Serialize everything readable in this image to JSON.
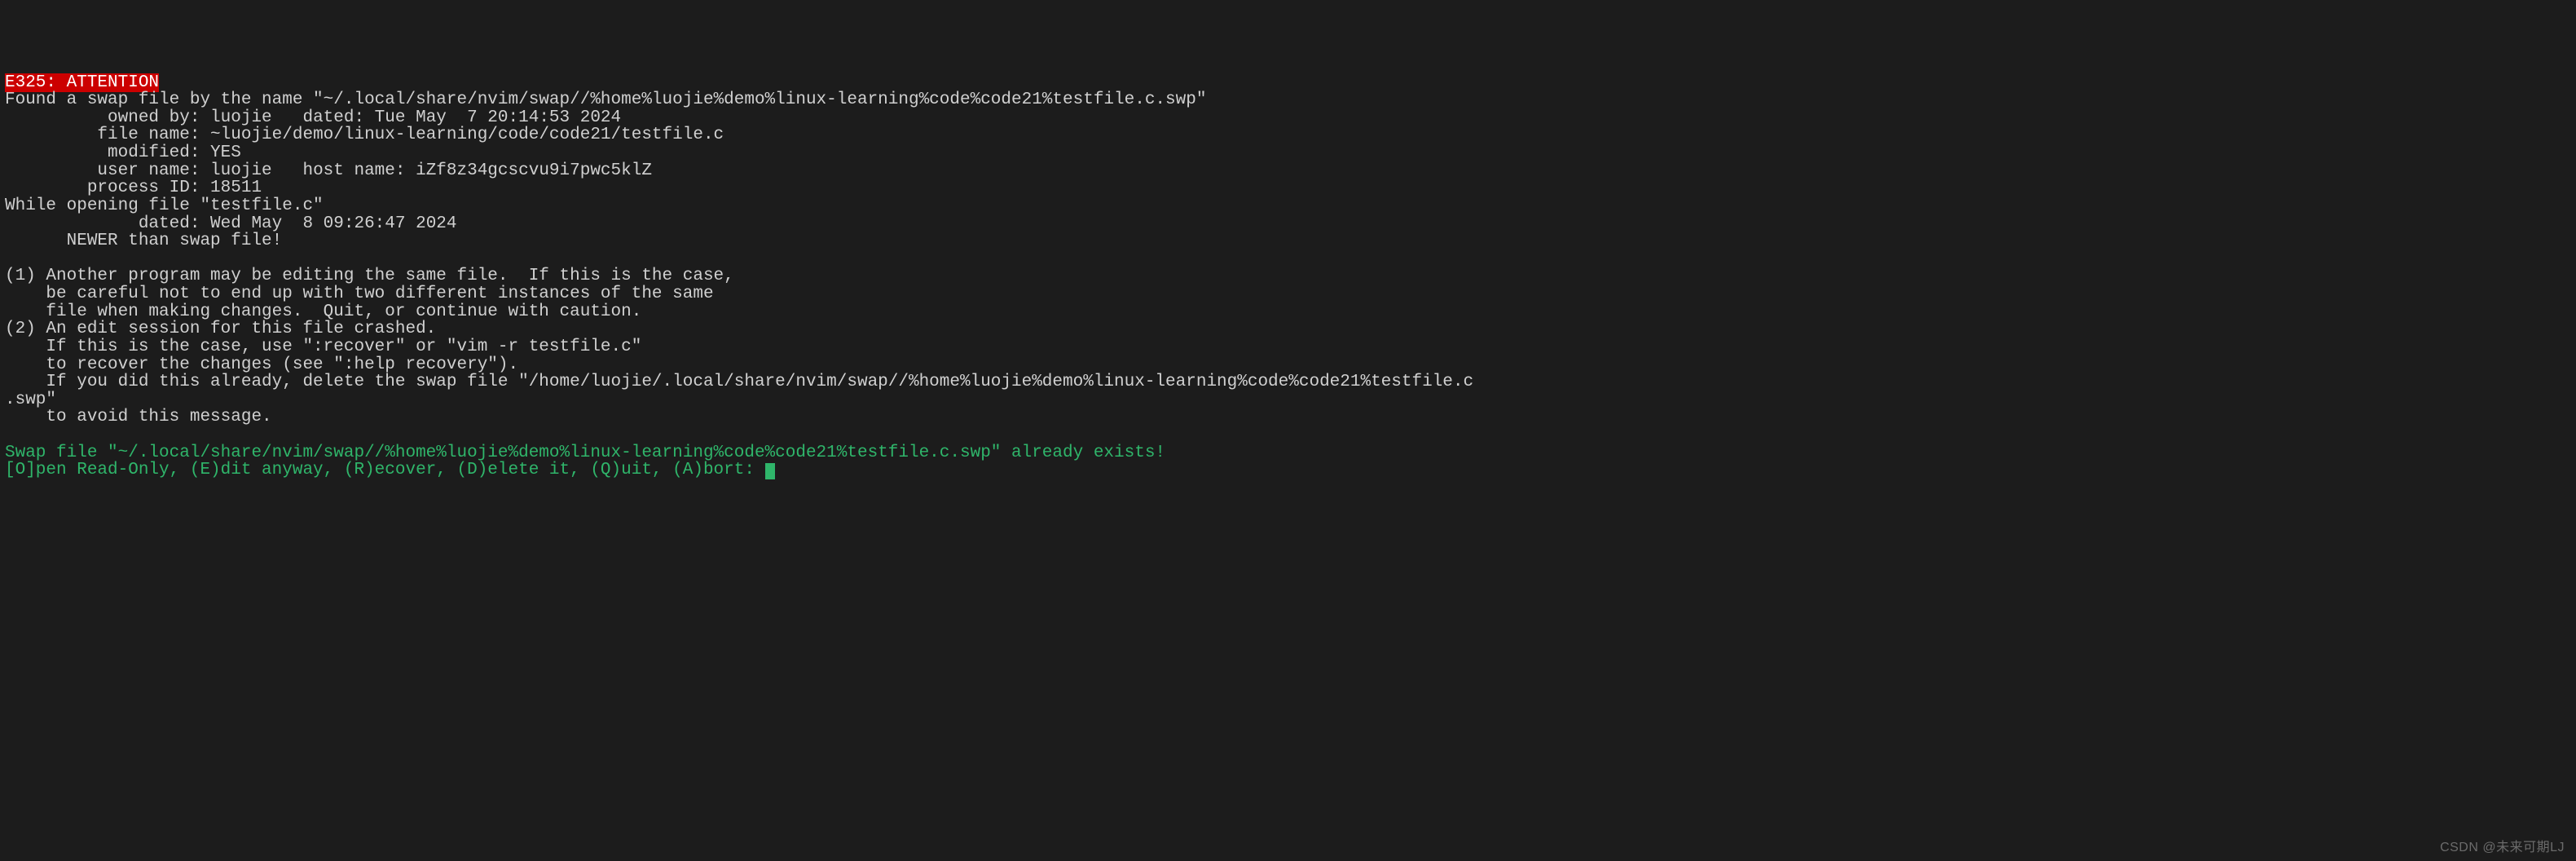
{
  "error_header": "E325: ATTENTION",
  "line_found": "Found a swap file by the name \"~/.local/share/nvim/swap//%home%luojie%demo%linux-learning%code%code21%testfile.c.swp\"",
  "owned_by_label": "          owned by: ",
  "owned_by_value": "luojie   dated: Tue May  7 20:14:53 2024",
  "file_name_label": "         file name: ",
  "file_name_value": "~luojie/demo/linux-learning/code/code21/testfile.c",
  "modified_label": "          modified: ",
  "modified_value": "YES",
  "user_name_label": "         user name: ",
  "user_name_value": "luojie   host name: iZf8z34gcscvu9i7pwc5klZ",
  "process_id_label": "        process ID: ",
  "process_id_value": "18511",
  "while_opening": "While opening file \"testfile.c\"",
  "dated_label": "             dated: ",
  "dated_value": "Wed May  8 09:26:47 2024",
  "newer": "      NEWER than swap file!",
  "blank": "",
  "scenario1_l1": "(1) Another program may be editing the same file.  If this is the case,",
  "scenario1_l2": "    be careful not to end up with two different instances of the same",
  "scenario1_l3": "    file when making changes.  Quit, or continue with caution.",
  "scenario2_l1": "(2) An edit session for this file crashed.",
  "scenario2_l2": "    If this is the case, use \":recover\" or \"vim -r testfile.c\"",
  "scenario2_l3": "    to recover the changes (see \":help recovery\").",
  "scenario2_l4": "    If you did this already, delete the swap file \"/home/luojie/.local/share/nvim/swap//%home%luojie%demo%linux-learning%code%code21%testfile.c",
  "scenario2_l5": ".swp\"",
  "scenario2_l6": "    to avoid this message.",
  "swap_exists": "Swap file \"~/.local/share/nvim/swap//%home%luojie%demo%linux-learning%code%code21%testfile.c.swp\" already exists!",
  "prompt": "[O]pen Read-Only, (E)dit anyway, (R)ecover, (D)elete it, (Q)uit, (A)bort: ",
  "watermark": "CSDN @未来可期LJ"
}
